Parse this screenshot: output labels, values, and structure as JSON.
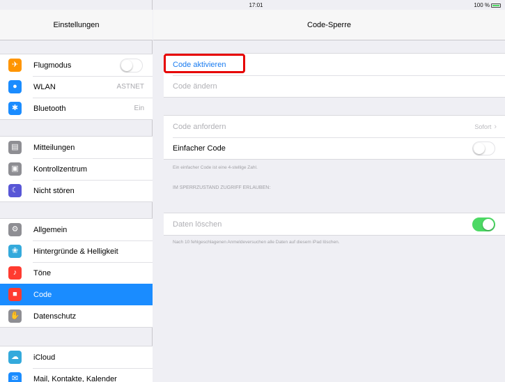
{
  "status_bar": {
    "device": "iPad",
    "wifi_icon": "wifi-icon",
    "time": "17:01",
    "battery": "100 %",
    "battery_level": 1.0
  },
  "sidebar": {
    "title": "Einstellungen",
    "groups": [
      [
        {
          "label": "Flugmodus",
          "icon": "airplane-icon",
          "icon_color": "#ff9500",
          "toggle": false
        },
        {
          "label": "WLAN",
          "icon": "wifi-icon",
          "icon_color": "#1a8cff",
          "value": "ASTNET"
        },
        {
          "label": "Bluetooth",
          "icon": "bluetooth-icon",
          "icon_color": "#1a8cff",
          "value": "Ein"
        }
      ],
      [
        {
          "label": "Mitteilungen",
          "icon": "notifications-icon",
          "icon_color": "#8e8e93"
        },
        {
          "label": "Kontrollzentrum",
          "icon": "control-center-icon",
          "icon_color": "#8e8e93"
        },
        {
          "label": "Nicht stören",
          "icon": "moon-icon",
          "icon_color": "#5856d6"
        }
      ],
      [
        {
          "label": "Allgemein",
          "icon": "gear-icon",
          "icon_color": "#8e8e93"
        },
        {
          "label": "Hintergründe & Helligkeit",
          "icon": "wallpaper-icon",
          "icon_color": "#34aadc"
        },
        {
          "label": "Töne",
          "icon": "sound-icon",
          "icon_color": "#ff3b30"
        },
        {
          "label": "Code",
          "icon": "lock-icon",
          "icon_color": "#ff3b30",
          "selected": true
        },
        {
          "label": "Datenschutz",
          "icon": "hand-icon",
          "icon_color": "#8e8e93"
        }
      ],
      [
        {
          "label": "iCloud",
          "icon": "cloud-icon",
          "icon_color": "#34aadc"
        },
        {
          "label": "Mail, Kontakte, Kalender",
          "icon": "mail-icon",
          "icon_color": "#1a8cff"
        }
      ]
    ]
  },
  "main": {
    "title": "Code-Sperre",
    "code_activate": "Code aktivieren",
    "code_change": "Code ändern",
    "require_code": "Code anfordern",
    "require_code_value": "Sofort",
    "simple_code": "Einfacher Code",
    "simple_code_on": false,
    "simple_code_footer": "Ein einfacher Code ist eine 4-stellige Zahl.",
    "lock_section_header": "IM SPERRZUSTAND ZUGRIFF ERLAUBEN:",
    "erase_data": "Daten löschen",
    "erase_data_on": true,
    "erase_footer": "Nach 10 fehlgeschlagenen Anmeldeversuchen alle Daten auf diesem iPad löschen."
  },
  "annotation_color": "#e60000"
}
